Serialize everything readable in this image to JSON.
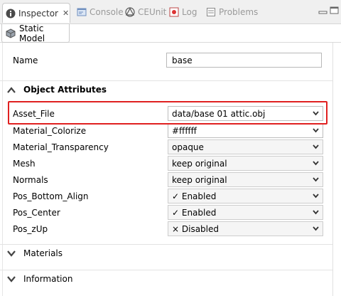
{
  "tabs": [
    {
      "label": "Inspector",
      "icon": "info-icon",
      "active": true
    },
    {
      "label": "Console",
      "icon": "console-icon"
    },
    {
      "label": "CEUnit",
      "icon": "ceunit-icon"
    },
    {
      "label": "Log",
      "icon": "log-icon"
    },
    {
      "label": "Problems",
      "icon": "problems-icon"
    }
  ],
  "close_symbol": "✕",
  "editor_tab": {
    "label": "Static Model",
    "icon": "cube-icon"
  },
  "name_row": {
    "label": "Name",
    "value": "base"
  },
  "object_attributes": {
    "title": "Object Attributes",
    "expanded": true
  },
  "attributes": [
    {
      "label": "Asset_File",
      "value": "data/base 01 attic.obj",
      "white": true
    },
    {
      "label": "Material_Colorize",
      "value": "#ffffff",
      "white": true
    },
    {
      "label": "Material_Transparency",
      "value": "opaque"
    },
    {
      "label": "Mesh",
      "value": "keep original"
    },
    {
      "label": "Normals",
      "value": "keep original"
    },
    {
      "label": "Pos_Bottom_Align",
      "value": "✓ Enabled"
    },
    {
      "label": "Pos_Center",
      "value": "✓ Enabled"
    },
    {
      "label": "Pos_zUp",
      "value": "× Disabled"
    }
  ],
  "sections": [
    {
      "title": "Materials",
      "expanded": false
    },
    {
      "title": "Information",
      "expanded": false
    }
  ],
  "colors": {
    "highlight": "#e02020",
    "tab_bar": "#f0f0f0"
  }
}
